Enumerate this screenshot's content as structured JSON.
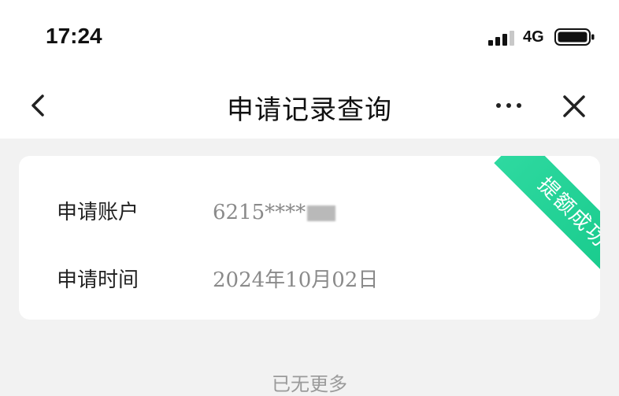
{
  "status_bar": {
    "time": "17:24",
    "network": "4G",
    "signal_bars": 3,
    "signal_icon": "signal-bars-icon",
    "battery_icon": "battery-icon"
  },
  "nav": {
    "title": "申请记录查询",
    "back_icon": "chevron-left-icon",
    "more_icon": "more-dots-icon",
    "close_icon": "close-icon"
  },
  "record": {
    "status_badge": "提额成功",
    "status_color": "#1fd196",
    "rows": [
      {
        "label": "申请账户",
        "value": "6215****"
      },
      {
        "label": "申请时间",
        "value": "2024年10月02日"
      }
    ]
  },
  "footer": {
    "text": "已无更多"
  }
}
